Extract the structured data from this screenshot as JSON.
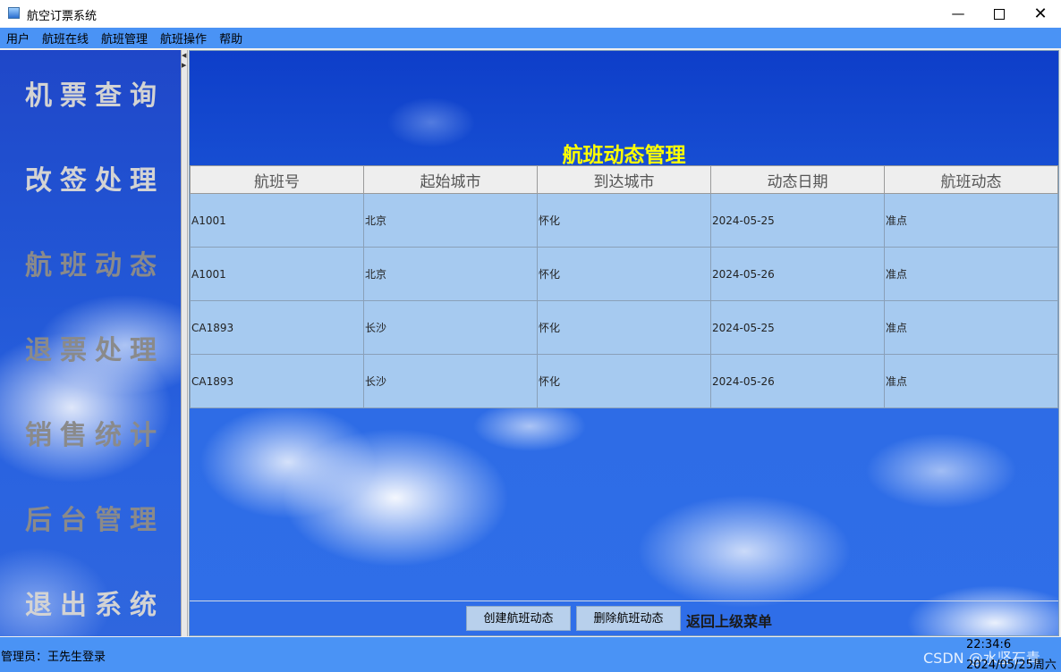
{
  "window": {
    "title": "航空订票系统",
    "minimize_glyph": "—",
    "close_glyph": "✕"
  },
  "menu": [
    "用户",
    "航班在线",
    "航班管理",
    "航班操作",
    "帮助"
  ],
  "nav": [
    "机票查询",
    "改签处理",
    "航班动态",
    "退票处理",
    "销售统计",
    "后台管理",
    "退出系统"
  ],
  "main": {
    "title": "航班动态管理",
    "columns": [
      "航班号",
      "起始城市",
      "到达城市",
      "动态日期",
      "航班动态"
    ],
    "rows": [
      [
        "A1001",
        "北京",
        "怀化",
        "2024-05-25",
        "准点"
      ],
      [
        "A1001",
        "北京",
        "怀化",
        "2024-05-26",
        "准点"
      ],
      [
        "CA1893",
        "长沙",
        "怀化",
        "2024-05-25",
        "准点"
      ],
      [
        "CA1893",
        "长沙",
        "怀化",
        "2024-05-26",
        "准点"
      ]
    ],
    "buttons": {
      "create": "创建航班动态",
      "delete": "删除航班动态"
    },
    "back": "返回上级菜单"
  },
  "status": {
    "text": "管理员：王先生登录",
    "time": "22:34:6",
    "date": "2024/05/25周六",
    "watermark": "CSDN @水坚石青"
  },
  "colors": {
    "menubar": "#4a93f5",
    "title_yellow": "#ffff00",
    "cell_blue": "#a6caf0"
  }
}
